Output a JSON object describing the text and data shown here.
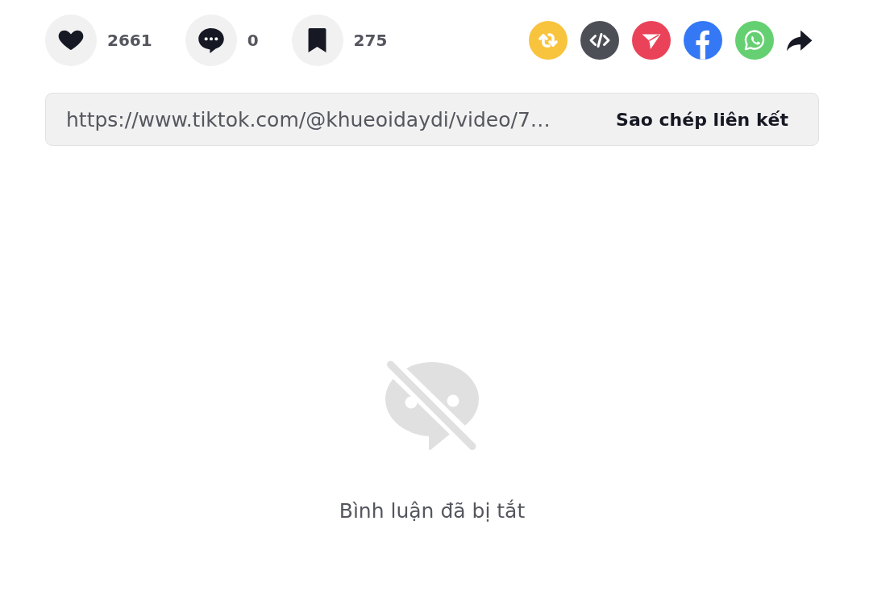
{
  "engagement": [
    {
      "kind": "like",
      "count": "2661"
    },
    {
      "kind": "comment",
      "count": "0"
    },
    {
      "kind": "bookmark",
      "count": "275"
    }
  ],
  "share_targets": [
    {
      "kind": "repost",
      "color": "#f8c43e"
    },
    {
      "kind": "embed",
      "color": "#4c4f56"
    },
    {
      "kind": "send",
      "color": "#ea4359"
    },
    {
      "kind": "facebook",
      "color": "#3478f6"
    },
    {
      "kind": "whatsapp",
      "color": "#65d072"
    },
    {
      "kind": "more"
    }
  ],
  "link_bar": {
    "url": "https://www.tiktok.com/@khueoidaydi/video/7…",
    "button": "Sao chép liên kết"
  },
  "comments": {
    "message": "Bình luận đã bị tắt"
  }
}
